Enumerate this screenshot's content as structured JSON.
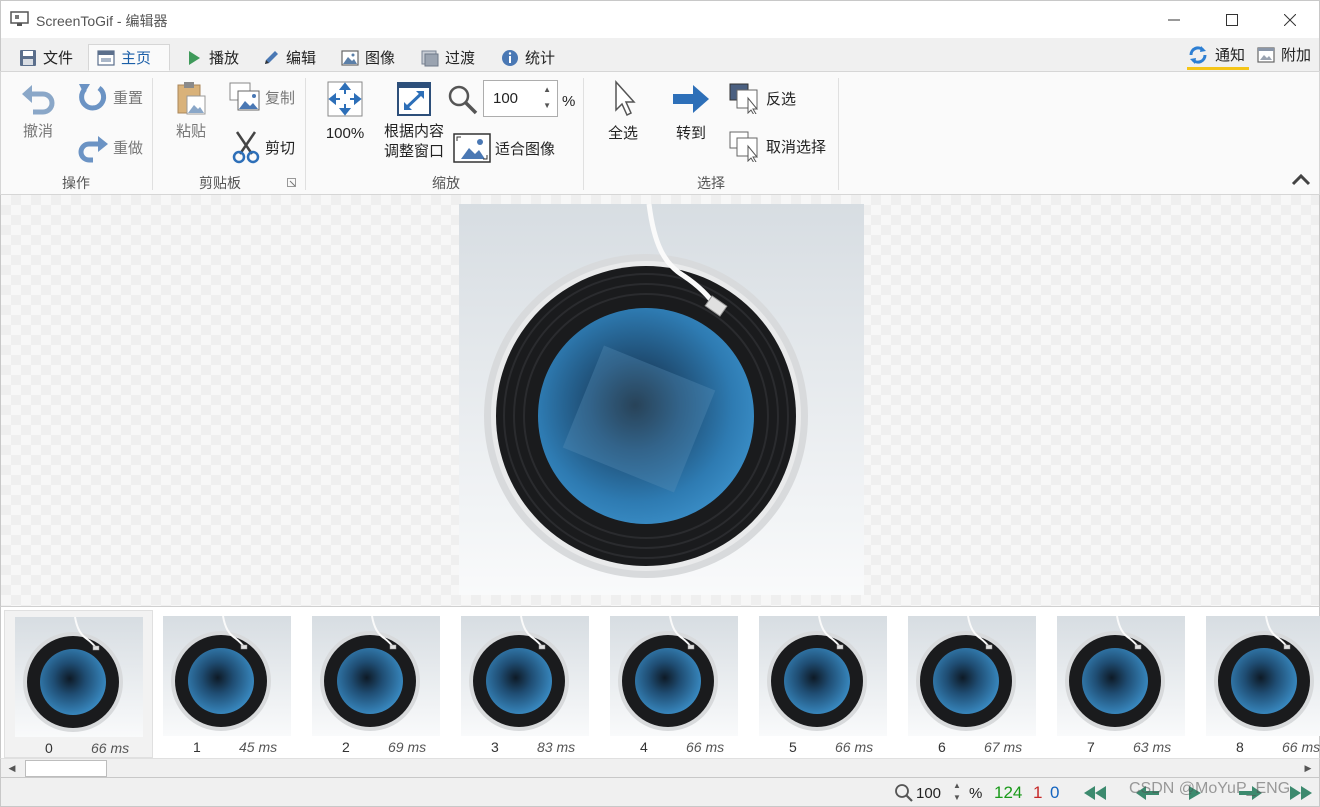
{
  "window": {
    "title": "ScreenToGif - 编辑器",
    "app_icon": "monitor-icon"
  },
  "tabs": [
    {
      "label": "文件",
      "icon": "save-icon"
    },
    {
      "label": "主页",
      "icon": "home-window-icon",
      "active": true
    },
    {
      "label": "播放",
      "icon": "play-icon"
    },
    {
      "label": "编辑",
      "icon": "pencil-icon"
    },
    {
      "label": "图像",
      "icon": "image-icon"
    },
    {
      "label": "过渡",
      "icon": "transition-icon"
    },
    {
      "label": "统计",
      "icon": "info-icon"
    }
  ],
  "right_tabs": [
    {
      "label": "通知",
      "icon": "refresh-icon"
    },
    {
      "label": "附加",
      "icon": "extras-icon"
    }
  ],
  "ribbon": {
    "actions": {
      "label": "操作",
      "undo": "撤消",
      "reset": "重置",
      "redo": "重做"
    },
    "clipboard": {
      "label": "剪贴板",
      "paste": "粘贴",
      "copy": "复制",
      "cut": "剪切"
    },
    "zoom": {
      "label": "缩放",
      "hundred": "100%",
      "fit_window_line1": "根据内容",
      "fit_window_line2": "调整窗口",
      "zoom_value": "100",
      "percent": "%",
      "fit_image": "适合图像"
    },
    "select": {
      "label": "选择",
      "select_all": "全选",
      "goto": "转到",
      "invert": "反选",
      "deselect": "取消选择"
    }
  },
  "frames": [
    {
      "index": "0",
      "duration": "66 ms",
      "selected": true
    },
    {
      "index": "1",
      "duration": "45 ms"
    },
    {
      "index": "2",
      "duration": "69 ms"
    },
    {
      "index": "3",
      "duration": "83 ms"
    },
    {
      "index": "4",
      "duration": "66 ms"
    },
    {
      "index": "5",
      "duration": "66 ms"
    },
    {
      "index": "6",
      "duration": "67 ms"
    },
    {
      "index": "7",
      "duration": "63 ms"
    },
    {
      "index": "8",
      "duration": "66 ms"
    }
  ],
  "status": {
    "zoom": "100",
    "percent": "%",
    "total_frames": "124",
    "selected_frames": "1",
    "current_frame": "0",
    "watermark": "CSDN @MoYuP_ENG"
  },
  "colors": {
    "accent_blue": "#1b5fa8",
    "green_count": "#1a9a1a",
    "red_count": "#c62828",
    "blue_count": "#1565c0",
    "nav_green": "#3c8a6e"
  }
}
